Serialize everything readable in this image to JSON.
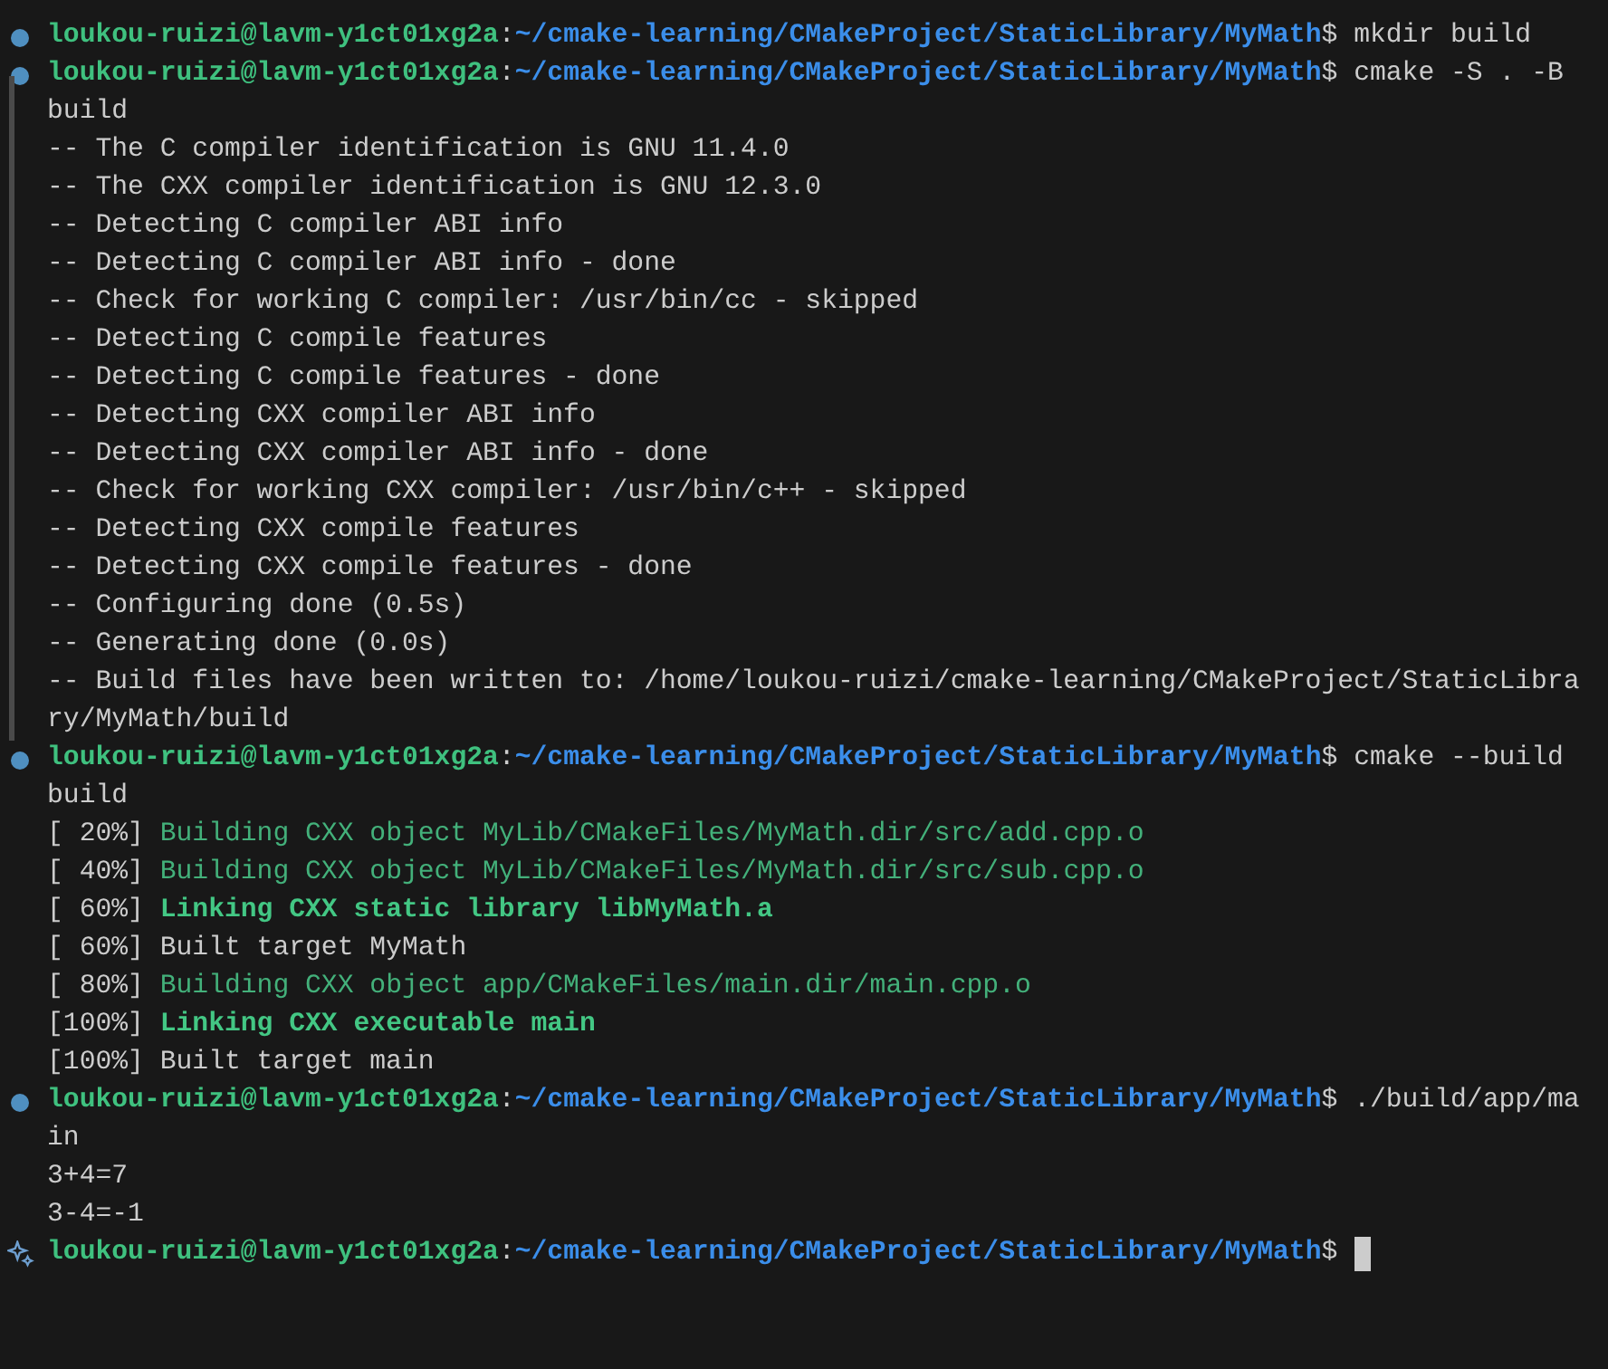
{
  "terminal": {
    "blocks": [
      {
        "kind": "finished",
        "highlighted": false,
        "user_host": "loukou-ruizi@lavm-y1ct01xg2a",
        "separator": ":",
        "path": "~/cmake-learning/CMakeProject/StaticLibrary/MyMath",
        "symbol": "$",
        "command": [
          "mkdir build"
        ]
      },
      {
        "kind": "finished",
        "highlighted": true,
        "user_host": "loukou-ruizi@lavm-y1ct01xg2a",
        "separator": ":",
        "path": "~/cmake-learning/CMakeProject/StaticLibrary/MyMath",
        "symbol": "$",
        "command": [
          "cmake -S . -B",
          "build"
        ],
        "output": [
          [
            {
              "text": "-- The C compiler identification is GNU 11.4.0",
              "kind": "text"
            }
          ],
          [
            {
              "text": "-- The CXX compiler identification is GNU 12.3.0",
              "kind": "text"
            }
          ],
          [
            {
              "text": "-- Detecting C compiler ABI info",
              "kind": "text"
            }
          ],
          [
            {
              "text": "-- Detecting C compiler ABI info - done",
              "kind": "text"
            }
          ],
          [
            {
              "text": "-- Check for working C compiler: /usr/bin/cc - skipped",
              "kind": "text"
            }
          ],
          [
            {
              "text": "-- Detecting C compile features",
              "kind": "text"
            }
          ],
          [
            {
              "text": "-- Detecting C compile features - done",
              "kind": "text"
            }
          ],
          [
            {
              "text": "-- Detecting CXX compiler ABI info",
              "kind": "text"
            }
          ],
          [
            {
              "text": "-- Detecting CXX compiler ABI info - done",
              "kind": "text"
            }
          ],
          [
            {
              "text": "-- Check for working CXX compiler: /usr/bin/c++ - skipped",
              "kind": "text"
            }
          ],
          [
            {
              "text": "-- Detecting CXX compile features",
              "kind": "text"
            }
          ],
          [
            {
              "text": "-- Detecting CXX compile features - done",
              "kind": "text"
            }
          ],
          [
            {
              "text": "-- Configuring done (0.5s)",
              "kind": "text"
            }
          ],
          [
            {
              "text": "-- Generating done (0.0s)",
              "kind": "text"
            }
          ],
          [
            {
              "text": "-- Build files have been written to: /home/loukou-ruizi/cmake-learning/CMakeProject/StaticLibra",
              "kind": "text"
            }
          ],
          [
            {
              "text": "ry/MyMath/build",
              "kind": "text"
            }
          ]
        ]
      },
      {
        "kind": "finished",
        "highlighted": false,
        "user_host": "loukou-ruizi@lavm-y1ct01xg2a",
        "separator": ":",
        "path": "~/cmake-learning/CMakeProject/StaticLibrary/MyMath",
        "symbol": "$",
        "command": [
          "cmake --build",
          "build"
        ],
        "output": [
          [
            {
              "text": "[ 20%] ",
              "kind": "text"
            },
            {
              "text": "Building CXX object MyLib/CMakeFiles/MyMath.dir/src/add.cpp.o",
              "kind": "compile"
            }
          ],
          [
            {
              "text": "[ 40%] ",
              "kind": "text"
            },
            {
              "text": "Building CXX object MyLib/CMakeFiles/MyMath.dir/src/sub.cpp.o",
              "kind": "compile"
            }
          ],
          [
            {
              "text": "[ 60%] ",
              "kind": "text"
            },
            {
              "text": "Linking CXX static library libMyMath.a",
              "kind": "link"
            }
          ],
          [
            {
              "text": "[ 60%] Built target MyMath",
              "kind": "text"
            }
          ],
          [
            {
              "text": "[ 80%] ",
              "kind": "text"
            },
            {
              "text": "Building CXX object app/CMakeFiles/main.dir/main.cpp.o",
              "kind": "compile"
            }
          ],
          [
            {
              "text": "[100%] ",
              "kind": "text"
            },
            {
              "text": "Linking CXX executable main",
              "kind": "link"
            }
          ],
          [
            {
              "text": "[100%] Built target main",
              "kind": "text"
            }
          ]
        ]
      },
      {
        "kind": "finished",
        "highlighted": false,
        "user_host": "loukou-ruizi@lavm-y1ct01xg2a",
        "separator": ":",
        "path": "~/cmake-learning/CMakeProject/StaticLibrary/MyMath",
        "symbol": "$",
        "command": [
          "./build/app/ma",
          "in"
        ],
        "output": [
          [
            {
              "text": "3+4=7",
              "kind": "text"
            }
          ],
          [
            {
              "text": "3-4=-1",
              "kind": "text"
            }
          ]
        ]
      },
      {
        "kind": "current",
        "highlighted": false,
        "user_host": "loukou-ruizi@lavm-y1ct01xg2a",
        "separator": ":",
        "path": "~/cmake-learning/CMakeProject/StaticLibrary/MyMath",
        "symbol": "$"
      }
    ]
  }
}
